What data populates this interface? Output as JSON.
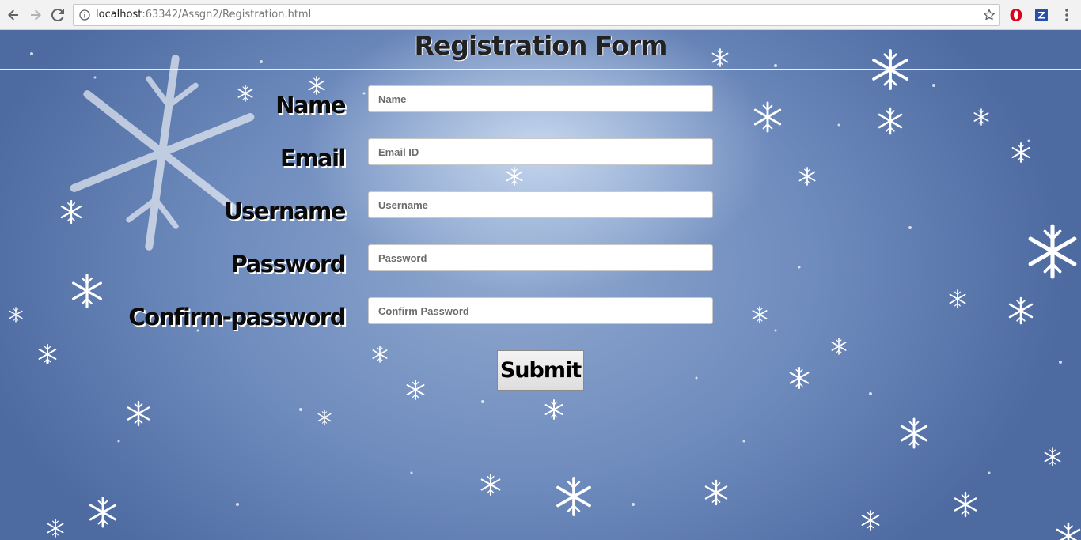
{
  "browser": {
    "url_host": "localhost",
    "url_path": ":63342/Assgn2/Registration.html"
  },
  "page": {
    "title": "Registration Form"
  },
  "form": {
    "fields": [
      {
        "label": "Name",
        "placeholder": "Name",
        "value": ""
      },
      {
        "label": "Email",
        "placeholder": "Email ID",
        "value": ""
      },
      {
        "label": "Username",
        "placeholder": "Username",
        "value": ""
      },
      {
        "label": "Password",
        "placeholder": "Password",
        "value": ""
      },
      {
        "label": "Confirm-password",
        "placeholder": "Confirm Password",
        "value": ""
      }
    ],
    "submit_label": "Submit"
  },
  "icons": {
    "back": "arrow-left-icon",
    "forward": "arrow-right-icon",
    "reload": "reload-icon",
    "site_info": "info-icon",
    "bookmark": "star-icon",
    "opera_ext": "opera-icon",
    "z_ext": "z-extension-icon",
    "menu": "kebab-menu-icon"
  },
  "colors": {
    "background": "#6e8bbd",
    "label_text": "#0a0a0a",
    "label_shadow": "#ffffff",
    "opera_red": "#e0001b",
    "z_blue": "#2a4fa8"
  }
}
